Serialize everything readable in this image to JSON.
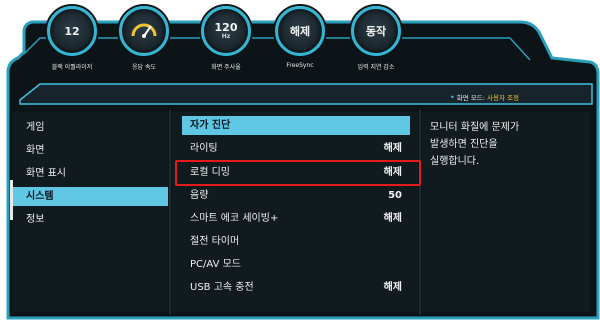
{
  "top_gauges": [
    {
      "value": "12",
      "unit": "",
      "label": "블랙 이퀄라이저",
      "icon": "number-icon"
    },
    {
      "value": "",
      "unit": "",
      "label": "응답 속도",
      "icon": "speedometer-icon"
    },
    {
      "value": "120",
      "unit": "Hz",
      "label": "화면 주사율",
      "icon": "number-icon"
    },
    {
      "value": "해제",
      "unit": "",
      "label": "FreeSync",
      "icon": "text-icon"
    },
    {
      "value": "동작",
      "unit": "",
      "label": "입력 지연 감소",
      "icon": "text-icon"
    }
  ],
  "mode_line": {
    "label": "화면 모드: ",
    "value": "사용자 조정"
  },
  "left_menu": {
    "items": [
      "게임",
      "화면",
      "화면 표시",
      "시스템",
      "정보"
    ],
    "selected": "시스템"
  },
  "middle_menu": {
    "items": [
      {
        "label": "자가 진단",
        "value": "",
        "selected": true
      },
      {
        "label": "라이팅",
        "value": "해제"
      },
      {
        "label": "로컬 디밍",
        "value": "해제",
        "highlighted": true
      },
      {
        "label": "음량",
        "value": "50"
      },
      {
        "label": "스마트 에코 세이빙+",
        "value": "해제"
      },
      {
        "label": "절전 타이머",
        "value": ""
      },
      {
        "label": "PC/AV 모드",
        "value": ""
      },
      {
        "label": "USB 고속 충전",
        "value": "해제"
      }
    ]
  },
  "help_text": "모니터 화질에 문제가\n발생하면 진단을\n실행합니다.",
  "colors": {
    "frame_dark": "#111a1f",
    "accent_cyan": "#3fc1dd",
    "selection": "#5fc6e4",
    "highlight_red": "#e51b1b",
    "mode_value": "#f1c232"
  }
}
